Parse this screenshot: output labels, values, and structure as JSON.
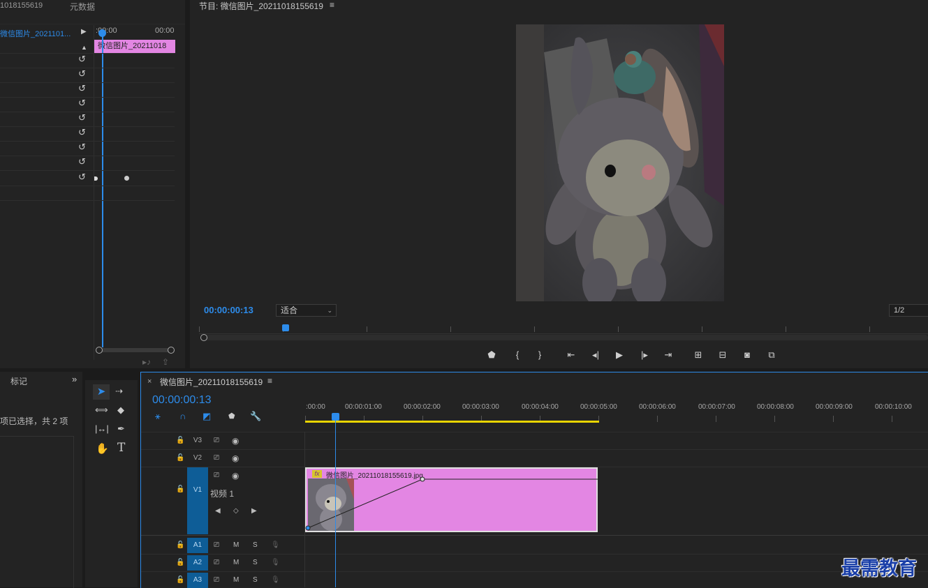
{
  "effect_controls": {
    "tab_source_name": "1018155619",
    "tab_metadata": "元数据",
    "clip_name": "微信图片_2021101...",
    "time_start": ":00:00",
    "time_end": "00:00",
    "clip_bar_label": "微信图片_20211018"
  },
  "program_monitor": {
    "title": "节目: 微信图片_20211018155619",
    "menu_icon": "hamburger-icon",
    "timecode": "00:00:00:13",
    "fit_label": "适合",
    "resolution": "1/2"
  },
  "markers_panel": {
    "tab_label": "标记",
    "expand_icon": "double-chevron-icon",
    "selection_status": "项已选择，共 2 项"
  },
  "timeline": {
    "sequence_name": "微信图片_20211018155619",
    "timecode": "00:00:00:13",
    "ruler_labels": [
      ":00:00",
      "00:00:01:00",
      "00:00:02:00",
      "00:00:03:00",
      "00:00:04:00",
      "00:00:05:00",
      "00:00:06:00",
      "00:00:07:00",
      "00:00:08:00",
      "00:00:09:00",
      "00:00:10:00"
    ],
    "tracks": {
      "v3": "V3",
      "v2": "V2",
      "v1": "V1",
      "v1_label": "视频 1",
      "a1": "A1",
      "a2": "A2",
      "a3": "A3",
      "mute": "M",
      "solo": "S"
    },
    "clip": {
      "label": "微信图片_20211018155619.jpg",
      "fx_badge": "fx",
      "color": "#e386e3"
    }
  },
  "watermark": "最需教育",
  "colors": {
    "accent": "#2d8ceb",
    "clip_pink": "#e386e3",
    "work_area": "#e8d400",
    "track_blue": "#0e5d97"
  }
}
